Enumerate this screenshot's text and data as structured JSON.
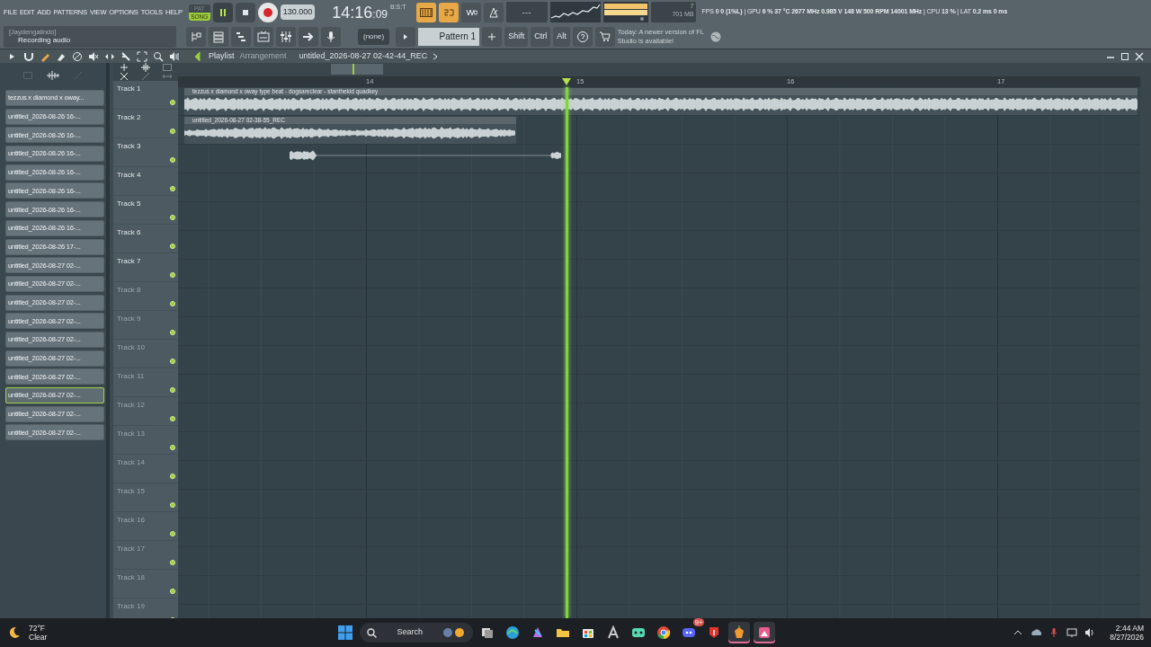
{
  "menu": [
    "FILE",
    "EDIT",
    "ADD",
    "PATTERNS",
    "VIEW",
    "OPTIONS",
    "TOOLS",
    "HELP"
  ],
  "mode_toggle": [
    {
      "label": "PAT",
      "selected": false
    },
    {
      "label": "SONG",
      "selected": true
    }
  ],
  "transport": {
    "playing": true,
    "recording": true
  },
  "tempo": "130.000",
  "time": {
    "main": "14:16",
    "seconds": ":09",
    "unit": "B:S:T"
  },
  "snap_display": "---",
  "memory": {
    "count": "7",
    "size": "701 MB"
  },
  "stats": "FPS **0  0 (1%L)**  |  GPU  **6 %  37 °C  2677 MHz  0.985 V  148 W  500 RPM  14001 MHz**  |  CPU  **13 %**  |  LAT  **0.2 ms  0 ms**",
  "hint": {
    "user": "[Jaydengalindo]",
    "text": "Recording audio"
  },
  "channel_selector": "(none)",
  "pattern": "Pattern 1",
  "modifier_keys": [
    "Shift",
    "Ctrl",
    "Alt"
  ],
  "news": "Today: A newer version of FL Studio is available!",
  "playlist": {
    "title": "Playlist",
    "subtitle": "Arrangement",
    "arrangement_name": "untitled_2026-08-27 02-42-44_REC",
    "ruler": [
      "14",
      "15",
      "16",
      "17"
    ],
    "tracks": [
      {
        "name": "Track 1",
        "dimmed": false,
        "on": true,
        "clips": [
          {
            "kind": "audio",
            "title": "tezzus x diamond x oway type beat - dogsareclear - stanthekid quadkey"
          }
        ]
      },
      {
        "name": "Track 2",
        "dimmed": false,
        "on": true,
        "clips": [
          {
            "kind": "audio",
            "title": "untitled_2026-08-27 02-38-55_REC"
          }
        ]
      },
      {
        "name": "Track 3",
        "dimmed": false,
        "on": true,
        "clips": [
          {
            "kind": "recording"
          }
        ]
      },
      {
        "name": "Track 4",
        "dimmed": false,
        "on": true
      },
      {
        "name": "Track 5",
        "dimmed": false,
        "on": true
      },
      {
        "name": "Track 6",
        "dimmed": false,
        "on": true
      },
      {
        "name": "Track 7",
        "dimmed": false,
        "on": true
      },
      {
        "name": "Track 8",
        "dimmed": true,
        "on": true
      },
      {
        "name": "Track 9",
        "dimmed": true,
        "on": true
      },
      {
        "name": "Track 10",
        "dimmed": true,
        "on": true
      },
      {
        "name": "Track 11",
        "dimmed": true,
        "on": true
      },
      {
        "name": "Track 12",
        "dimmed": true,
        "on": true
      },
      {
        "name": "Track 13",
        "dimmed": true,
        "on": true
      },
      {
        "name": "Track 14",
        "dimmed": true,
        "on": true
      },
      {
        "name": "Track 15",
        "dimmed": true,
        "on": true
      },
      {
        "name": "Track 16",
        "dimmed": true,
        "on": true
      },
      {
        "name": "Track 17",
        "dimmed": true,
        "on": true
      },
      {
        "name": "Track 18",
        "dimmed": true,
        "on": true
      },
      {
        "name": "Track 19",
        "dimmed": true,
        "on": true
      }
    ]
  },
  "browser": {
    "clips": [
      {
        "name": "tezzus x diamond x oway...",
        "selected": false
      },
      {
        "name": "untitled_2026-08-26 16-...",
        "selected": false
      },
      {
        "name": "untitled_2026-08-26 16-...",
        "selected": false
      },
      {
        "name": "untitled_2026-08-26 16-...",
        "selected": false
      },
      {
        "name": "untitled_2026-08-26 16-...",
        "selected": false
      },
      {
        "name": "untitled_2026-08-26 16-...",
        "selected": false
      },
      {
        "name": "untitled_2026-08-26 16-...",
        "selected": false
      },
      {
        "name": "untitled_2026-08-26 16-...",
        "selected": false
      },
      {
        "name": "untitled_2026-08-26 17-...",
        "selected": false
      },
      {
        "name": "untitled_2026-08-27 02-...",
        "selected": false
      },
      {
        "name": "untitled_2026-08-27 02-...",
        "selected": false
      },
      {
        "name": "untitled_2026-08-27 02-...",
        "selected": false
      },
      {
        "name": "untitled_2026-08-27 02-...",
        "selected": false
      },
      {
        "name": "untitled_2026-08-27 02-...",
        "selected": false
      },
      {
        "name": "untitled_2026-08-27 02-...",
        "selected": false
      },
      {
        "name": "untitled_2026-08-27 02-...",
        "selected": false
      },
      {
        "name": "untitled_2026-08-27 02-...",
        "selected": true
      },
      {
        "name": "untitled_2026-08-27 02-...",
        "selected": false
      },
      {
        "name": "untitled_2026-08-27 02-...",
        "selected": false
      }
    ]
  },
  "taskbar": {
    "weather": {
      "temp": "72°F",
      "condition": "Clear"
    },
    "search": "Search",
    "apps": [
      {
        "selected": false
      },
      {
        "selected": false
      },
      {
        "selected": false
      },
      {
        "selected": false
      },
      {
        "selected": false
      },
      {
        "selected": false
      },
      {
        "selected": false
      },
      {
        "selected": false
      },
      {
        "selected": false
      },
      {
        "selected": false
      },
      {
        "selected": true
      },
      {
        "selected": true
      }
    ],
    "badge": "9+",
    "time": "2:44 AM",
    "date": "8/27/2026"
  }
}
